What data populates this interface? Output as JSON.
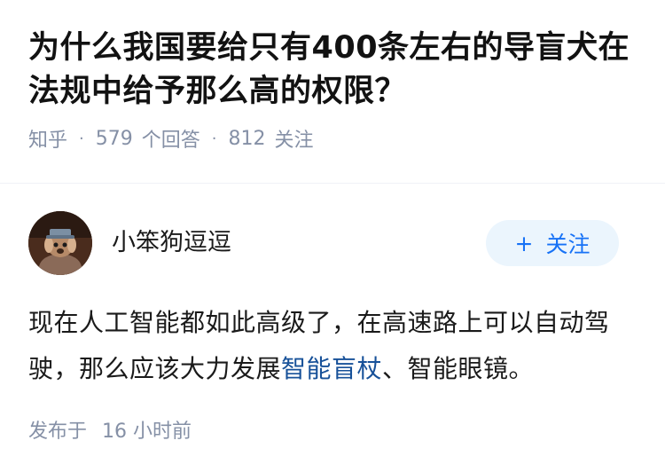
{
  "question": {
    "title": "为什么我国要给只有400条左右的导盲犬在法规中给予那么高的权限？",
    "source": "知乎",
    "answers_count": "579",
    "answers_label": "个回答",
    "followers_count": "812",
    "followers_label": "关注"
  },
  "answer": {
    "author": "小笨狗逗逗",
    "follow_label": "关注",
    "content_before": "现在人工智能都如此高级了，在高速路上可以自动驾驶，那么应该大力发展",
    "content_link": "智能盲杖",
    "content_after": "、智能眼镜。",
    "published_label": "发布于",
    "published_time": "16 小时前"
  },
  "colors": {
    "accent": "#1772f6",
    "link": "#175199",
    "meta": "#8590a6"
  }
}
